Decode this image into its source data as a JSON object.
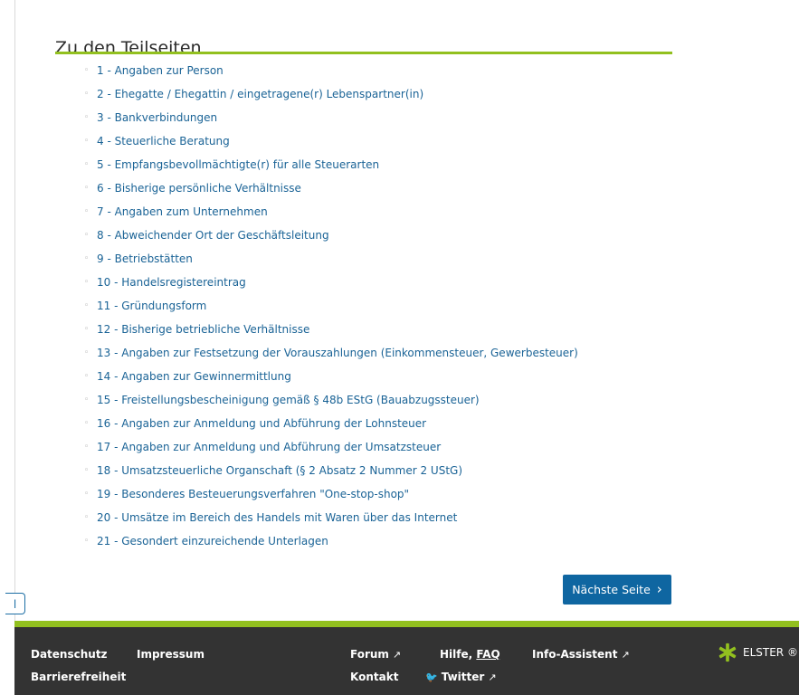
{
  "section": {
    "title": "Zu den Teilseiten"
  },
  "toc": [
    "1 - Angaben zur Person",
    "2 - Ehegatte / Ehegattin / eingetragene(r) Lebenspartner(in)",
    "3 - Bankverbindungen",
    "4 - Steuerliche Beratung",
    "5 - Empfangsbevollmächtigte(r) für alle Steuerarten",
    "6 - Bisherige persönliche Verhältnisse",
    "7 - Angaben zum Unternehmen",
    "8 - Abweichender Ort der Geschäftsleitung",
    "9 - Betriebstätten",
    "10 - Handelsregistereintrag",
    "11 - Gründungsform",
    "12 - Bisherige betriebliche Verhältnisse",
    "13 - Angaben zur Festsetzung der Vorauszahlungen (Einkommensteuer, Gewerbesteuer)",
    "14 - Angaben zur Gewinnermittlung",
    "15 - Freistellungsbescheinigung gemäß § 48b EStG (Bauabzugssteuer)",
    "16 - Angaben zur Anmeldung und Abführung der Lohnsteuer",
    "17 - Angaben zur Anmeldung und Abführung der Umsatzsteuer",
    "18 - Umsatzsteuerliche Organschaft (§ 2 Absatz 2 Nummer 2 UStG)",
    "19 - Besonderes Besteuerungsverfahren \"One-stop-shop\"",
    "20 - Umsätze im Bereich des Handels mit Waren über das Internet",
    "21 - Gesondert einzureichende Unterlagen"
  ],
  "back_fragment": "l",
  "next_button": {
    "label": "Nächste Seite",
    "chevron": "›"
  },
  "footer": {
    "datenschutz": "Datenschutz",
    "impressum": "Impressum",
    "barrierefreiheit": "Barrierefreiheit",
    "forum": "Forum",
    "hilfe": "Hilfe,",
    "faq": "FAQ",
    "info_assistent": "Info-Assistent",
    "kontakt": "Kontakt",
    "twitter": "Twitter",
    "external_glyph": "↗",
    "twitter_glyph": "🐦",
    "brand": "ELSTER ®"
  },
  "colors": {
    "accent_green": "#92c01f",
    "link_blue": "#1a6396",
    "button_blue": "#0f66a1",
    "footer_bg": "#333333"
  }
}
